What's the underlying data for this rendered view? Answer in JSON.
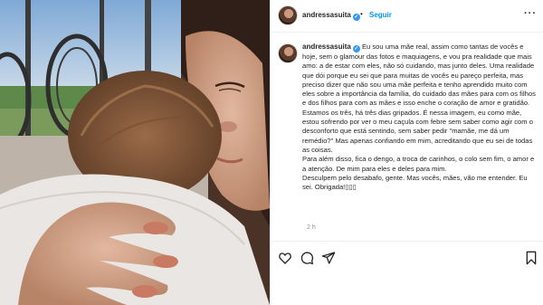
{
  "post": {
    "username": "andressasuita",
    "follow_label": "Seguir",
    "separator": "•",
    "more_label": "···",
    "verified_glyph": "✓",
    "caption_lines": [
      "Eu sou uma mãe real, assim como tantas de vocês e hoje, sem o glamour das fotos e maquiagens, e vou pra realidade que mais amo: a de estar com eles, não só cuidando, mas junto deles. Uma realidade que dói porque eu sei que para muitas de vocês eu pareço perfeita, mas preciso dizer que não sou uma mãe perfeita e tenho aprendido muito com eles sobre a importância da família, do cuidado das mães para com os filhos e dos filhos para com as mães e isso enche o coração de amor e gratidão. Estamos os três, há três dias gripados. É nessa imagem, eu como mãe, estou sofrendo por ver o meu caçula com febre sem saber como agir com o desconforto que está sentindo, sem saber pedir \"mamãe, me dá um remédio?\" Mas apenas confiando em mim, acreditando que eu sei de todas as coisas.",
      "Para além disso, fica o dengo, a troca de carinhos, o colo sem fim, o amor e a atenção. De mim para eles e deles para mim.",
      "Desculpem pelo desabafo, gente. Mas vocês, mães, vão me entender. Eu sei. Obrigada!▯▯▯"
    ],
    "time_ago": "2 h"
  },
  "icons": {
    "like": "heart-icon",
    "comment": "comment-icon",
    "share": "share-icon",
    "save": "bookmark-icon"
  },
  "colors": {
    "link_blue": "#0095f6",
    "verified_blue": "#3897f0",
    "muted_gray": "#8e8e8e",
    "text": "#262626"
  }
}
